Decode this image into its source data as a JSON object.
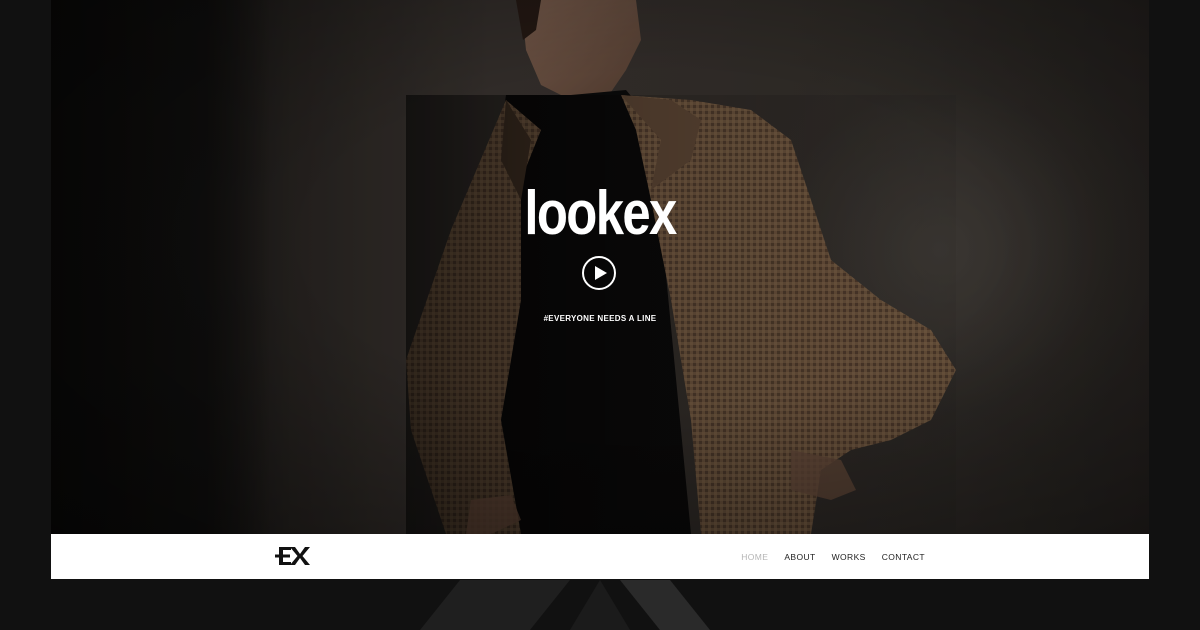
{
  "hero": {
    "title": "lookex",
    "tagline": "#EVERYONE NEEDS A LINE",
    "play_icon": "play-icon"
  },
  "nav": {
    "logo_icon": "ex-logo-icon",
    "items": [
      {
        "label": "HOME",
        "active": true
      },
      {
        "label": "ABOUT",
        "active": false
      },
      {
        "label": "WORKS",
        "active": false
      },
      {
        "label": "CONTACT",
        "active": false
      }
    ]
  },
  "colors": {
    "background": "#111111",
    "nav_background": "#ffffff",
    "nav_active": "#b5b5b5",
    "nav_text": "#222222",
    "title": "#ffffff"
  }
}
